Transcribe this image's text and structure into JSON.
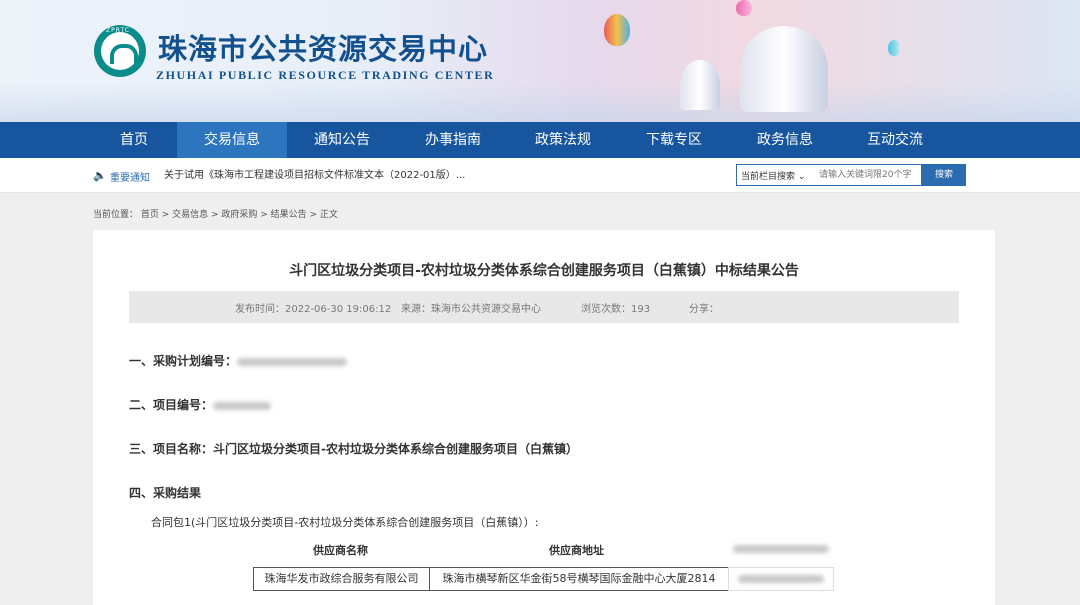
{
  "header": {
    "logo_tag": "ZPRTC",
    "site_title": "珠海市公共资源交易中心",
    "site_subtitle": "ZHUHAI PUBLIC RESOURCE TRADING CENTER"
  },
  "nav": {
    "items": [
      {
        "label": "首页"
      },
      {
        "label": "交易信息",
        "active": true
      },
      {
        "label": "通知公告"
      },
      {
        "label": "办事指南"
      },
      {
        "label": "政策法规"
      },
      {
        "label": "下载专区"
      },
      {
        "label": "政务信息"
      },
      {
        "label": "互动交流"
      }
    ]
  },
  "notice": {
    "label": "重要通知",
    "text": "关于试用《珠海市工程建设项目招标文件标准文本（2022-01版）..."
  },
  "search": {
    "category": "当前栏目搜索",
    "placeholder": "请输入关键词限20个字",
    "button": "搜索"
  },
  "breadcrumb": {
    "text": "当前位置： 首页 > 交易信息 > 政府采购 > 结果公告 > 正文"
  },
  "article": {
    "title": "斗门区垃圾分类项目-农村垃圾分类体系综合创建服务项目（白蕉镇）中标结果公告",
    "publish_time": "发布时间：2022-06-30 19:06:12",
    "source": "来源：珠海市公共资源交易中心",
    "views": "浏览次数：193",
    "share": "分享：",
    "sections": {
      "plan_no": "一、采购计划编号：",
      "project_no": "二、项目编号：",
      "project_name": "三、项目名称：斗门区垃圾分类项目-农村垃圾分类体系综合创建服务项目（白蕉镇）",
      "result": "四、采购结果"
    },
    "package_line": "合同包1(斗门区垃圾分类项目-农村垃圾分类体系综合创建服务项目（白蕉镇））:",
    "table": {
      "headers": [
        "供应商名称",
        "供应商地址"
      ],
      "row": [
        "珠海华发市政综合服务有限公司",
        "珠海市横琴新区华金街58号横琴国际金融中心大厦2814"
      ]
    }
  },
  "colors": {
    "nav_bg": "#17569f",
    "nav_active": "#2d76bf",
    "brand_blue": "#13508e",
    "logo_teal": "#0a8d8a"
  }
}
